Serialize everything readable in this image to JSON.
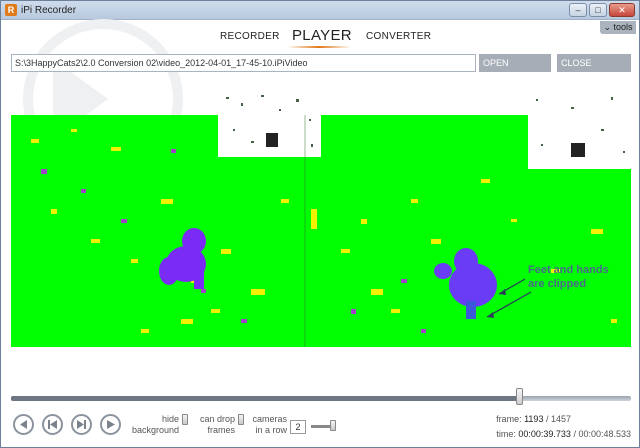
{
  "window": {
    "title": "iPi Recorder",
    "logo_letter": "R"
  },
  "window_controls": {
    "minimize": "–",
    "maximize": "□",
    "close": "✕"
  },
  "tools_label": "tools",
  "tabs": [
    {
      "label": "RECORDER",
      "active": false
    },
    {
      "label": "PLAYER",
      "active": true
    },
    {
      "label": "CONVERTER",
      "active": false
    }
  ],
  "file": {
    "path": "S:\\3HappyCats2\\2.0 Conversion 02\\video_2012-04-01_17-45-10.iPiVideo",
    "open_label": "OPEN",
    "close_label": "CLOSE"
  },
  "annotation": {
    "line1": "Feet and hands",
    "line2": "are clipped"
  },
  "playback": {
    "progress_fraction": 0.82,
    "options": {
      "hide_background": [
        "hide",
        "background"
      ],
      "can_drop_frames": [
        "can drop",
        "frames"
      ],
      "cameras_in_row": [
        "cameras",
        "in a row"
      ],
      "cameras_value": "2"
    },
    "frame_label": "frame:",
    "frame_current": "1193",
    "frame_total": "/ 1457",
    "time_label": "time:",
    "time_current": "00:00:39.733",
    "time_total": "/ 00:00:48.533"
  },
  "colors": {
    "accent": "#e07a1a",
    "depth_bg": "#00ff00",
    "subject": "#7a2cf5"
  }
}
